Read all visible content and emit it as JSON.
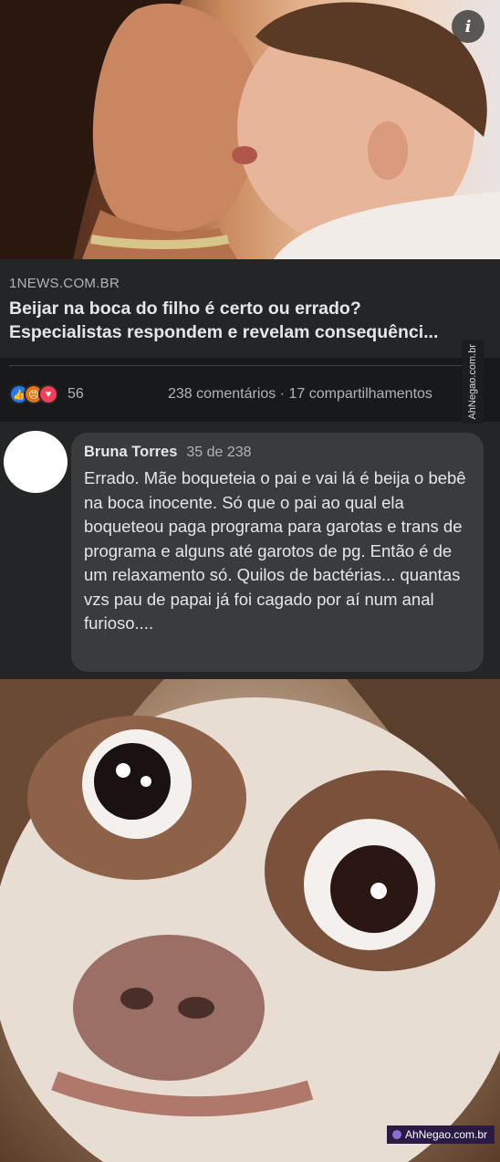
{
  "post": {
    "info_icon": "i",
    "preview": {
      "domain": "1NEWS.COM.BR",
      "title_line1": "Beijar na boca do filho é certo ou errado?",
      "title_line2": "Especialistas respondem e revelam consequênci..."
    },
    "stats": {
      "reactions": [
        "like-icon",
        "angry-icon",
        "love-icon"
      ],
      "reaction_count": "56",
      "comments_shares": "238 comentários · 17 compartilhamentos"
    }
  },
  "comment": {
    "author": "Bruna Torres",
    "position": "35 de 238",
    "text": "Errado. Mãe boqueteia o pai e vai lá é beija o bebê na boca inocente. Só que o pai ao qual ela boqueteou paga programa para garotas e trans de programa e alguns até garotos de pg. Então é de um relaxamento só. Quilos de bactérias... quantas vzs pau de papai já foi cagado por aí num anal furioso...."
  },
  "watermark": {
    "vertical": "AhNegao.com.br",
    "bottom": "AhNegao.com.br"
  }
}
